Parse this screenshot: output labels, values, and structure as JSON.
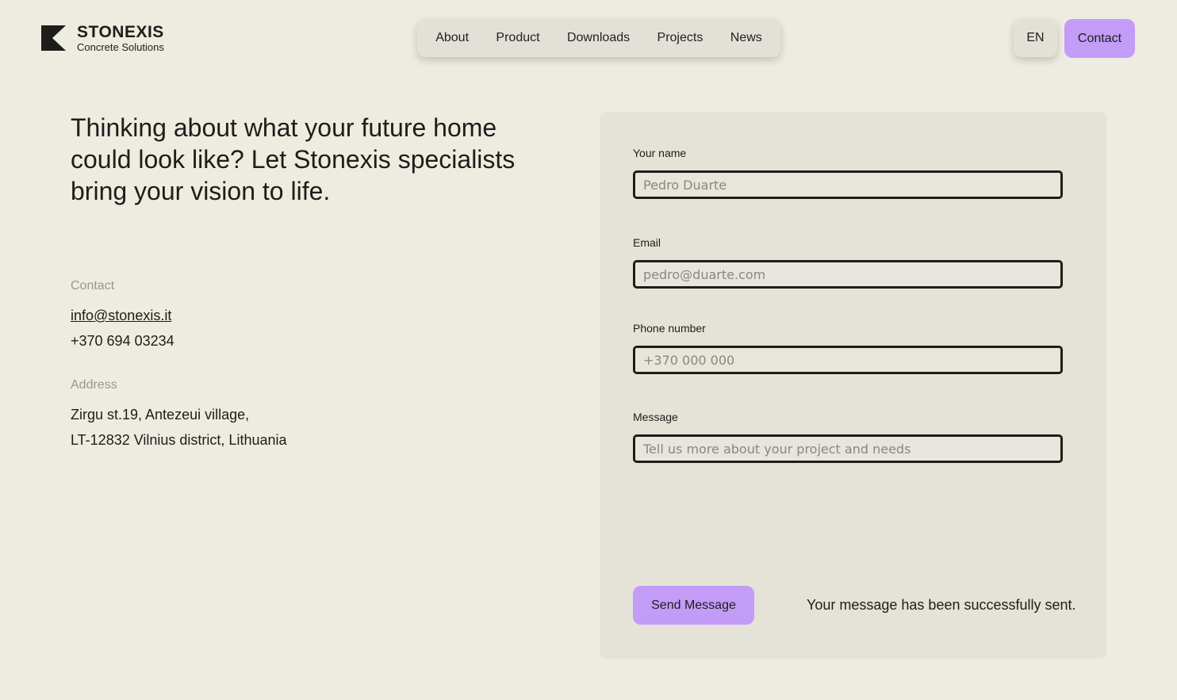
{
  "brand": {
    "name": "STONEXIS",
    "tagline": "Concrete Solutions"
  },
  "nav": {
    "items": [
      "About",
      "Product",
      "Downloads",
      "Projects",
      "News"
    ]
  },
  "header": {
    "lang_label": "EN",
    "contact_label": "Contact"
  },
  "hero": {
    "headline": "Thinking about what your future home could look like? Let Stonexis specialists bring your vision to life."
  },
  "contact": {
    "label": "Contact",
    "email": "info@stonexis.it",
    "phone": "+370 694 03234"
  },
  "address": {
    "label": "Address",
    "line1": "Zirgu st.19, Antezeui village,",
    "line2": "LT-12832 Vilnius district, Lithuania"
  },
  "form": {
    "name_label": "Your name",
    "name_placeholder": "Pedro Duarte",
    "email_label": "Email",
    "email_placeholder": "pedro@duarte.com",
    "phone_label": "Phone number",
    "phone_placeholder": "+370 000 000",
    "message_label": "Message",
    "message_placeholder": "Tell us more about your project and needs",
    "submit_label": "Send Message",
    "success_text": "Your message has been successfully sent."
  },
  "colors": {
    "accent": "#c39cf8",
    "background": "#eeebe1",
    "panel": "#e5e2d8"
  },
  "icons": {
    "logo": "stonexis-logo-icon"
  }
}
